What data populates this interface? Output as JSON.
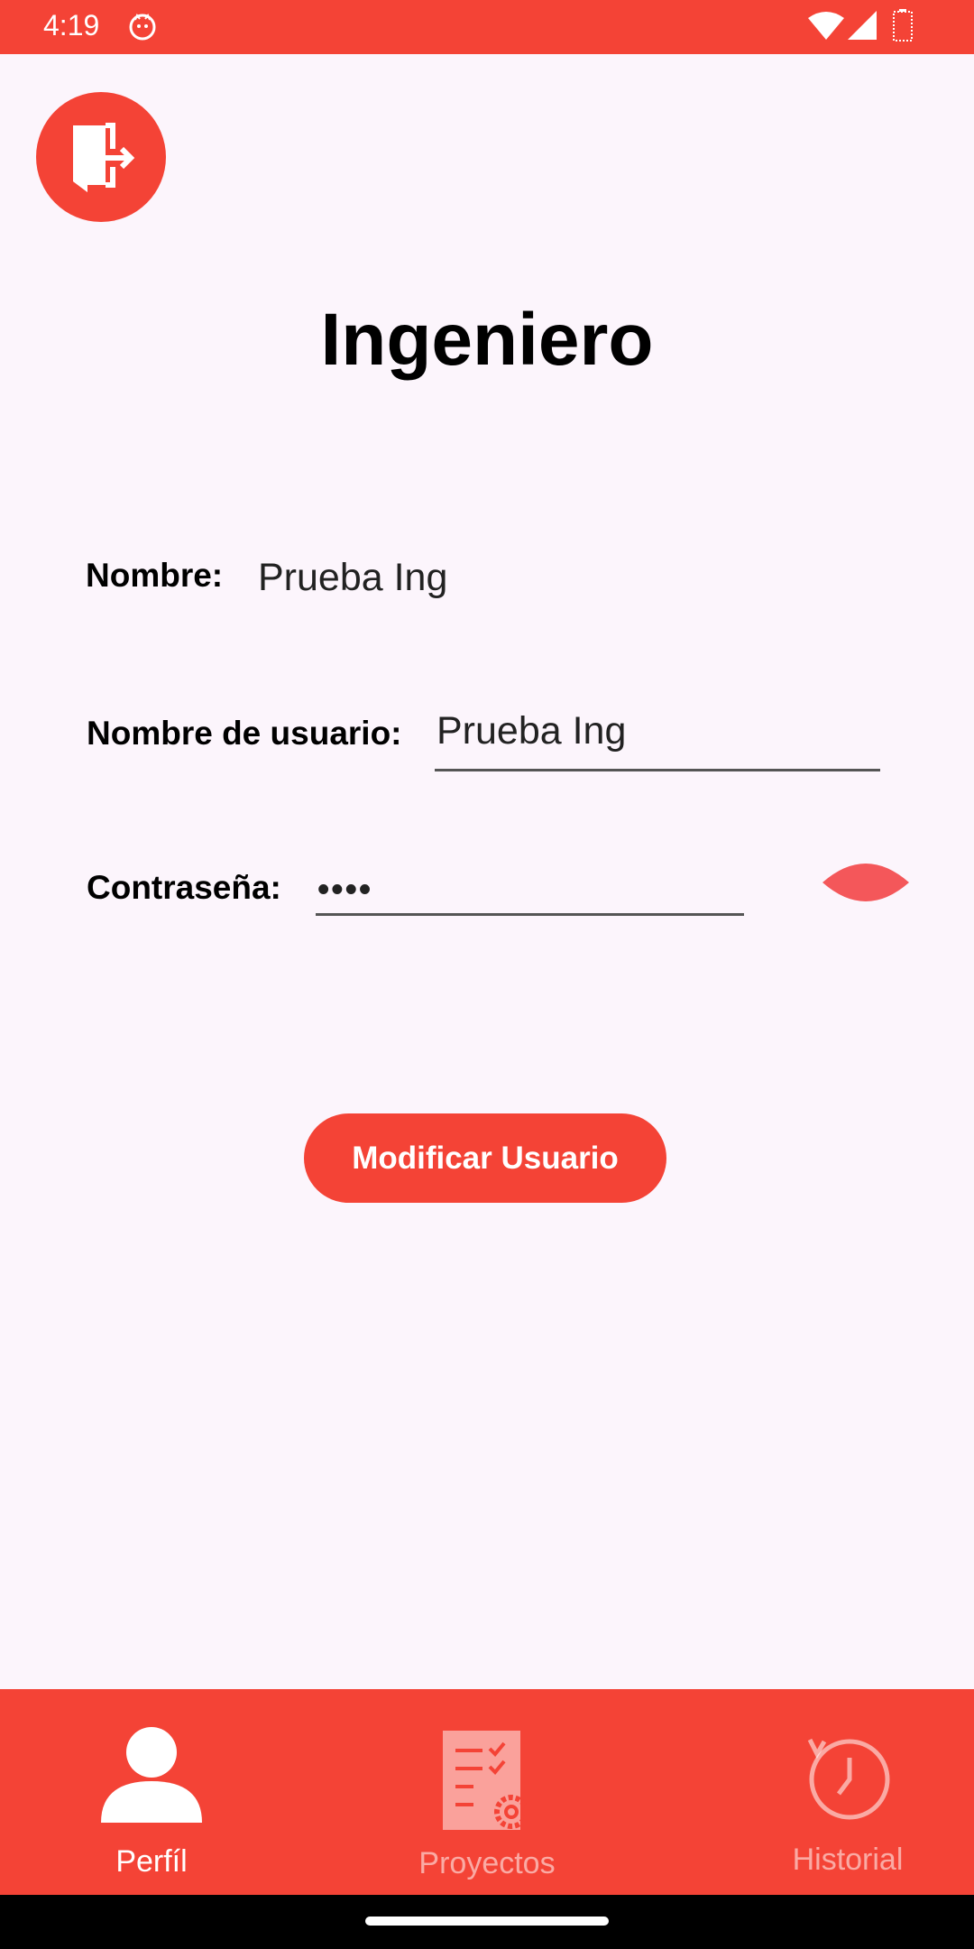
{
  "status_bar": {
    "time": "4:19",
    "app_icon": "cat-icon",
    "wifi_icon": "wifi-icon",
    "signal_icon": "signal-icon",
    "battery_icon": "battery-icon"
  },
  "header": {
    "logout_icon": "logout-door-icon",
    "title": "Ingeniero"
  },
  "form": {
    "nombre_label": "Nombre:",
    "nombre_value": "Prueba Ing",
    "usuario_label": "Nombre de usuario:",
    "usuario_value": "Prueba Ing",
    "password_label": "Contraseña:",
    "password_value": "••••",
    "eye_icon": "eye-toggle-icon"
  },
  "actions": {
    "modify_label": "Modificar Usuario"
  },
  "bottom_nav": {
    "items": [
      {
        "label": "Perfíl",
        "icon": "person-icon",
        "active": true
      },
      {
        "label": "Proyectos",
        "icon": "projects-checklist-icon",
        "active": false
      },
      {
        "label": "Historial",
        "icon": "history-clock-icon",
        "active": false
      }
    ]
  },
  "colors": {
    "accent": "#F44336",
    "background": "#FCF5FC",
    "eye": "#F4575A"
  }
}
